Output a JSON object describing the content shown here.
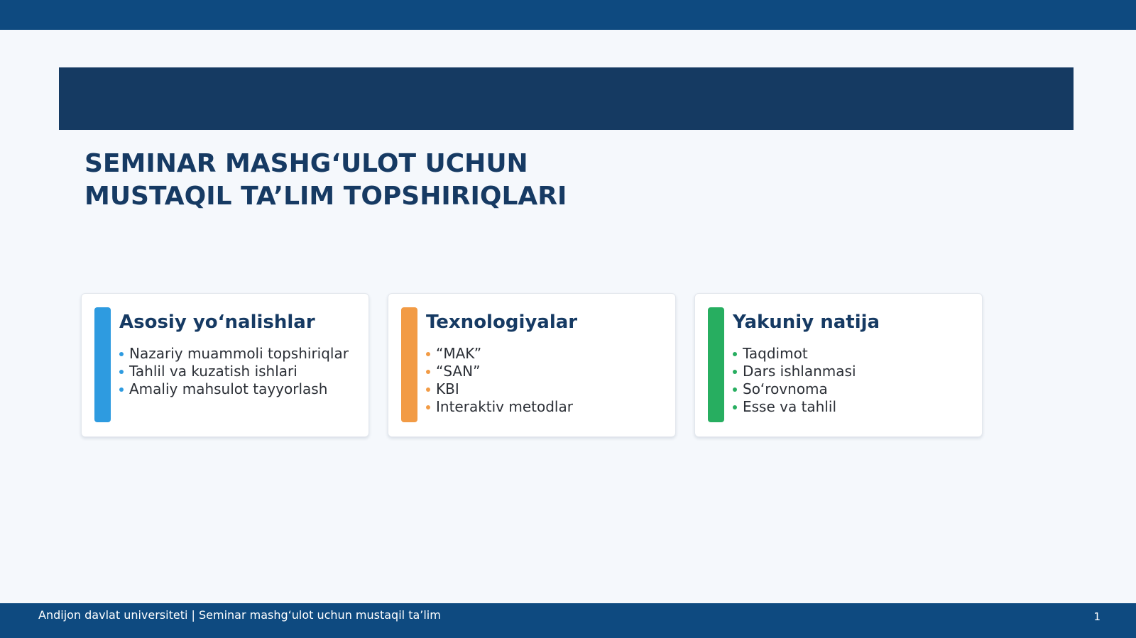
{
  "title": {
    "line1": "SEMINAR MASHG‘ULOT UCHUN",
    "line2": "MUSTAQIL TA’LIM TOPSHIRIQLARI"
  },
  "cards": [
    {
      "heading": "Asosiy yo‘nalishlar",
      "color": "#2e9be0",
      "items": [
        "Nazariy muammoli topshiriqlar",
        "Tahlil va kuzatish ishlari",
        "Amaliy mahsulot tayyorlash"
      ]
    },
    {
      "heading": "Texnologiyalar",
      "color": "#f29b45",
      "items": [
        "“MAK”",
        "“SAN”",
        "KBI",
        "Interaktiv metodlar"
      ]
    },
    {
      "heading": "Yakuniy natija",
      "color": "#27ae60",
      "items": [
        "Taqdimot",
        "Dars ishlanmasi",
        "So‘rovnoma",
        "Esse va tahlil"
      ]
    }
  ],
  "footer": {
    "text": "Andijon davlat universiteti | Seminar mashg‘ulot uchun mustaqil ta’lim",
    "page": "1"
  },
  "colors": {
    "top_bar": "#0e4a80",
    "header_band": "#153a62",
    "title": "#163a63",
    "background": "#f5f8fc"
  }
}
